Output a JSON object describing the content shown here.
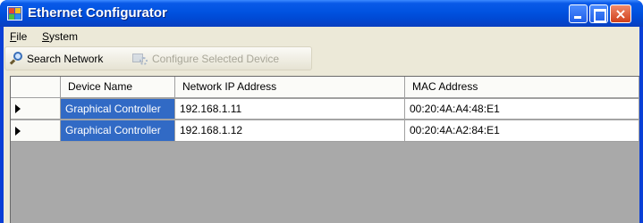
{
  "window": {
    "title": "Ethernet Configurator"
  },
  "title_buttons": {
    "close_glyph": "×"
  },
  "menu": {
    "file": {
      "mnemonic": "F",
      "rest": "ile"
    },
    "system": {
      "mnemonic": "S",
      "rest": "ystem"
    }
  },
  "toolbar": {
    "search_label": "Search Network",
    "configure_label": "Configure Selected Device"
  },
  "grid": {
    "columns": [
      "Device Name",
      "Network IP Address",
      "MAC Address"
    ],
    "rows": [
      [
        "Graphical Controller",
        "192.168.1.11",
        "00:20:4A:A4:48:E1"
      ],
      [
        "Graphical Controller",
        "192.168.1.12",
        "00:20:4A:A2:84:E1"
      ]
    ]
  },
  "colors": {
    "titlebar": "#0052e0",
    "selection": "#316ac5",
    "client_bg": "#ece9d8"
  },
  "icons": {
    "app": "app-icon",
    "search": "magnifier-icon",
    "configure": "configure-device-icon",
    "row_pointer": "row-pointer-icon"
  }
}
